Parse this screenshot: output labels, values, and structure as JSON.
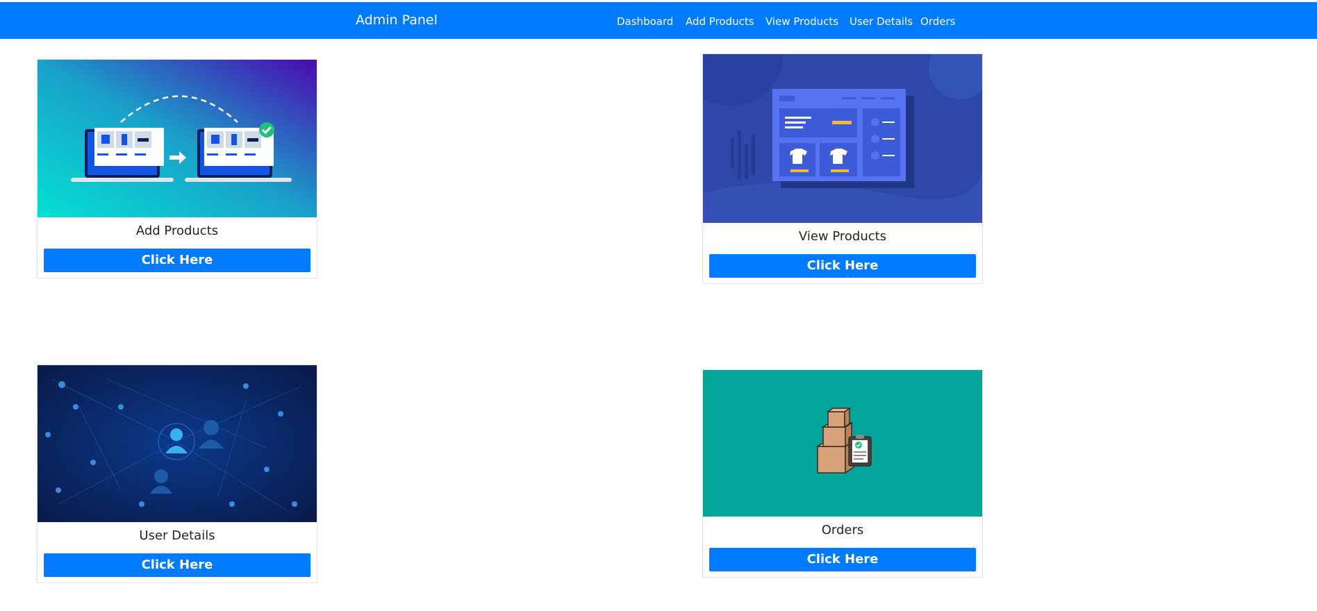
{
  "navbar": {
    "brand": "Admin Panel",
    "links": [
      "Dashboard",
      "Add Products",
      "View Products",
      "User Details",
      "Orders"
    ]
  },
  "cards": [
    {
      "title": "Add Products",
      "button": "Click Here",
      "image": "product-transfer-illustration"
    },
    {
      "title": "View Products",
      "button": "Click Here",
      "image": "product-dashboard-illustration"
    },
    {
      "title": "User Details",
      "button": "Click Here",
      "image": "user-network-illustration"
    },
    {
      "title": "Orders",
      "button": "Click Here",
      "image": "order-boxes-illustration"
    }
  ],
  "colors": {
    "primary": "#007bff",
    "card_border": "#e2e2e2",
    "orders_bg": "#03a59a"
  }
}
